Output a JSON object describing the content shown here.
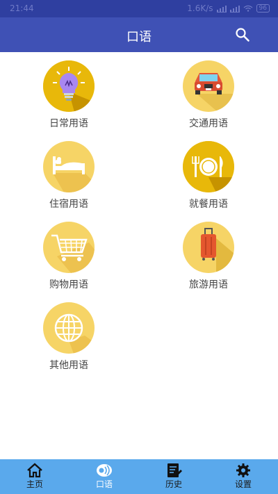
{
  "status_bar": {
    "time": "21:44",
    "net_speed": "1.6K/s",
    "battery": "96"
  },
  "header": {
    "title": "口语",
    "search_icon": "search-icon"
  },
  "categories": [
    {
      "label": "日常用语",
      "icon": "lightbulb-icon"
    },
    {
      "label": "交通用语",
      "icon": "car-icon"
    },
    {
      "label": "住宿用语",
      "icon": "bed-icon"
    },
    {
      "label": "就餐用语",
      "icon": "plate-icon"
    },
    {
      "label": "购物用语",
      "icon": "shopping-cart-icon"
    },
    {
      "label": "旅游用语",
      "icon": "suitcase-icon"
    },
    {
      "label": "其他用语",
      "icon": "globe-icon"
    }
  ],
  "tabs": [
    {
      "label": "主页",
      "icon": "home-icon"
    },
    {
      "label": "口语",
      "icon": "speech-icon",
      "active": true
    },
    {
      "label": "历史",
      "icon": "notebook-icon"
    },
    {
      "label": "设置",
      "icon": "gear-icon"
    }
  ],
  "colors": {
    "status_bar": "#2f3fa0",
    "app_bar": "#3f51b5",
    "tab_bar": "#5aa9ec",
    "icon_circle": "#f6d466"
  }
}
